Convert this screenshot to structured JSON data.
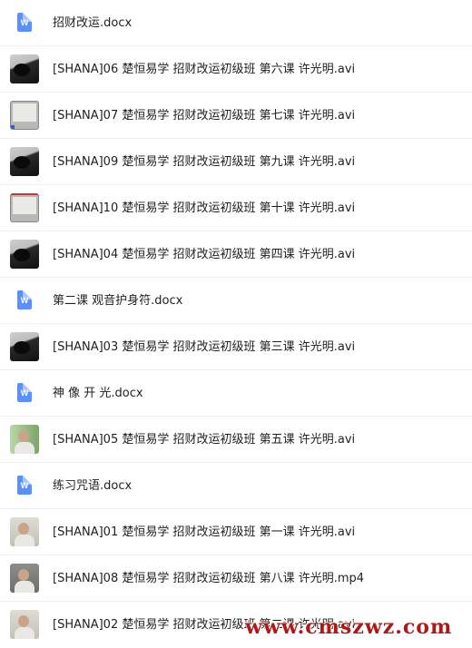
{
  "files": [
    {
      "name": "招财改运.docx",
      "type": "docx",
      "thumb": "doc"
    },
    {
      "name": "[SHANA]06 楚恒易学 招财改运初级班 第六课 许光明.avi",
      "type": "avi",
      "thumb": "dark"
    },
    {
      "name": "[SHANA]07 楚恒易学 招财改运初级班 第七课 许光明.avi",
      "type": "avi",
      "thumb": "board-blue"
    },
    {
      "name": "[SHANA]09 楚恒易学 招财改运初级班 第九课 许光明.avi",
      "type": "avi",
      "thumb": "dark"
    },
    {
      "name": "[SHANA]10 楚恒易学 招财改运初级班 第十课 许光明.avi",
      "type": "avi",
      "thumb": "board-red"
    },
    {
      "name": "[SHANA]04 楚恒易学 招财改运初级班 第四课 许光明.avi",
      "type": "avi",
      "thumb": "dark"
    },
    {
      "name": "第二课 观音护身符.docx",
      "type": "docx",
      "thumb": "doc"
    },
    {
      "name": "[SHANA]03 楚恒易学 招财改运初级班 第三课 许光明.avi",
      "type": "avi",
      "thumb": "dark"
    },
    {
      "name": "神 像 开 光.docx",
      "type": "docx",
      "thumb": "doc"
    },
    {
      "name": "[SHANA]05 楚恒易学 招财改运初级班 第五课 许光明.avi",
      "type": "avi",
      "thumb": "person-green"
    },
    {
      "name": "练习咒语.docx",
      "type": "docx",
      "thumb": "doc"
    },
    {
      "name": "[SHANA]01 楚恒易学 招财改运初级班 第一课 许光明.avi",
      "type": "avi",
      "thumb": "person-light"
    },
    {
      "name": "[SHANA]08 楚恒易学 招财改运初级班 第八课 许光明.mp4",
      "type": "mp4",
      "thumb": "person"
    },
    {
      "name": "[SHANA]02 楚恒易学 招财改运初级班 第二课 许光明.avi",
      "type": "avi",
      "thumb": "person-light"
    }
  ],
  "doc_icon_letter": "W",
  "watermark": "www.cmszwz.com",
  "colors": {
    "doc_icon": "#5b8ff9",
    "text": "#1f1f1f",
    "divider": "#eeeeee",
    "watermark": "#b01818"
  }
}
